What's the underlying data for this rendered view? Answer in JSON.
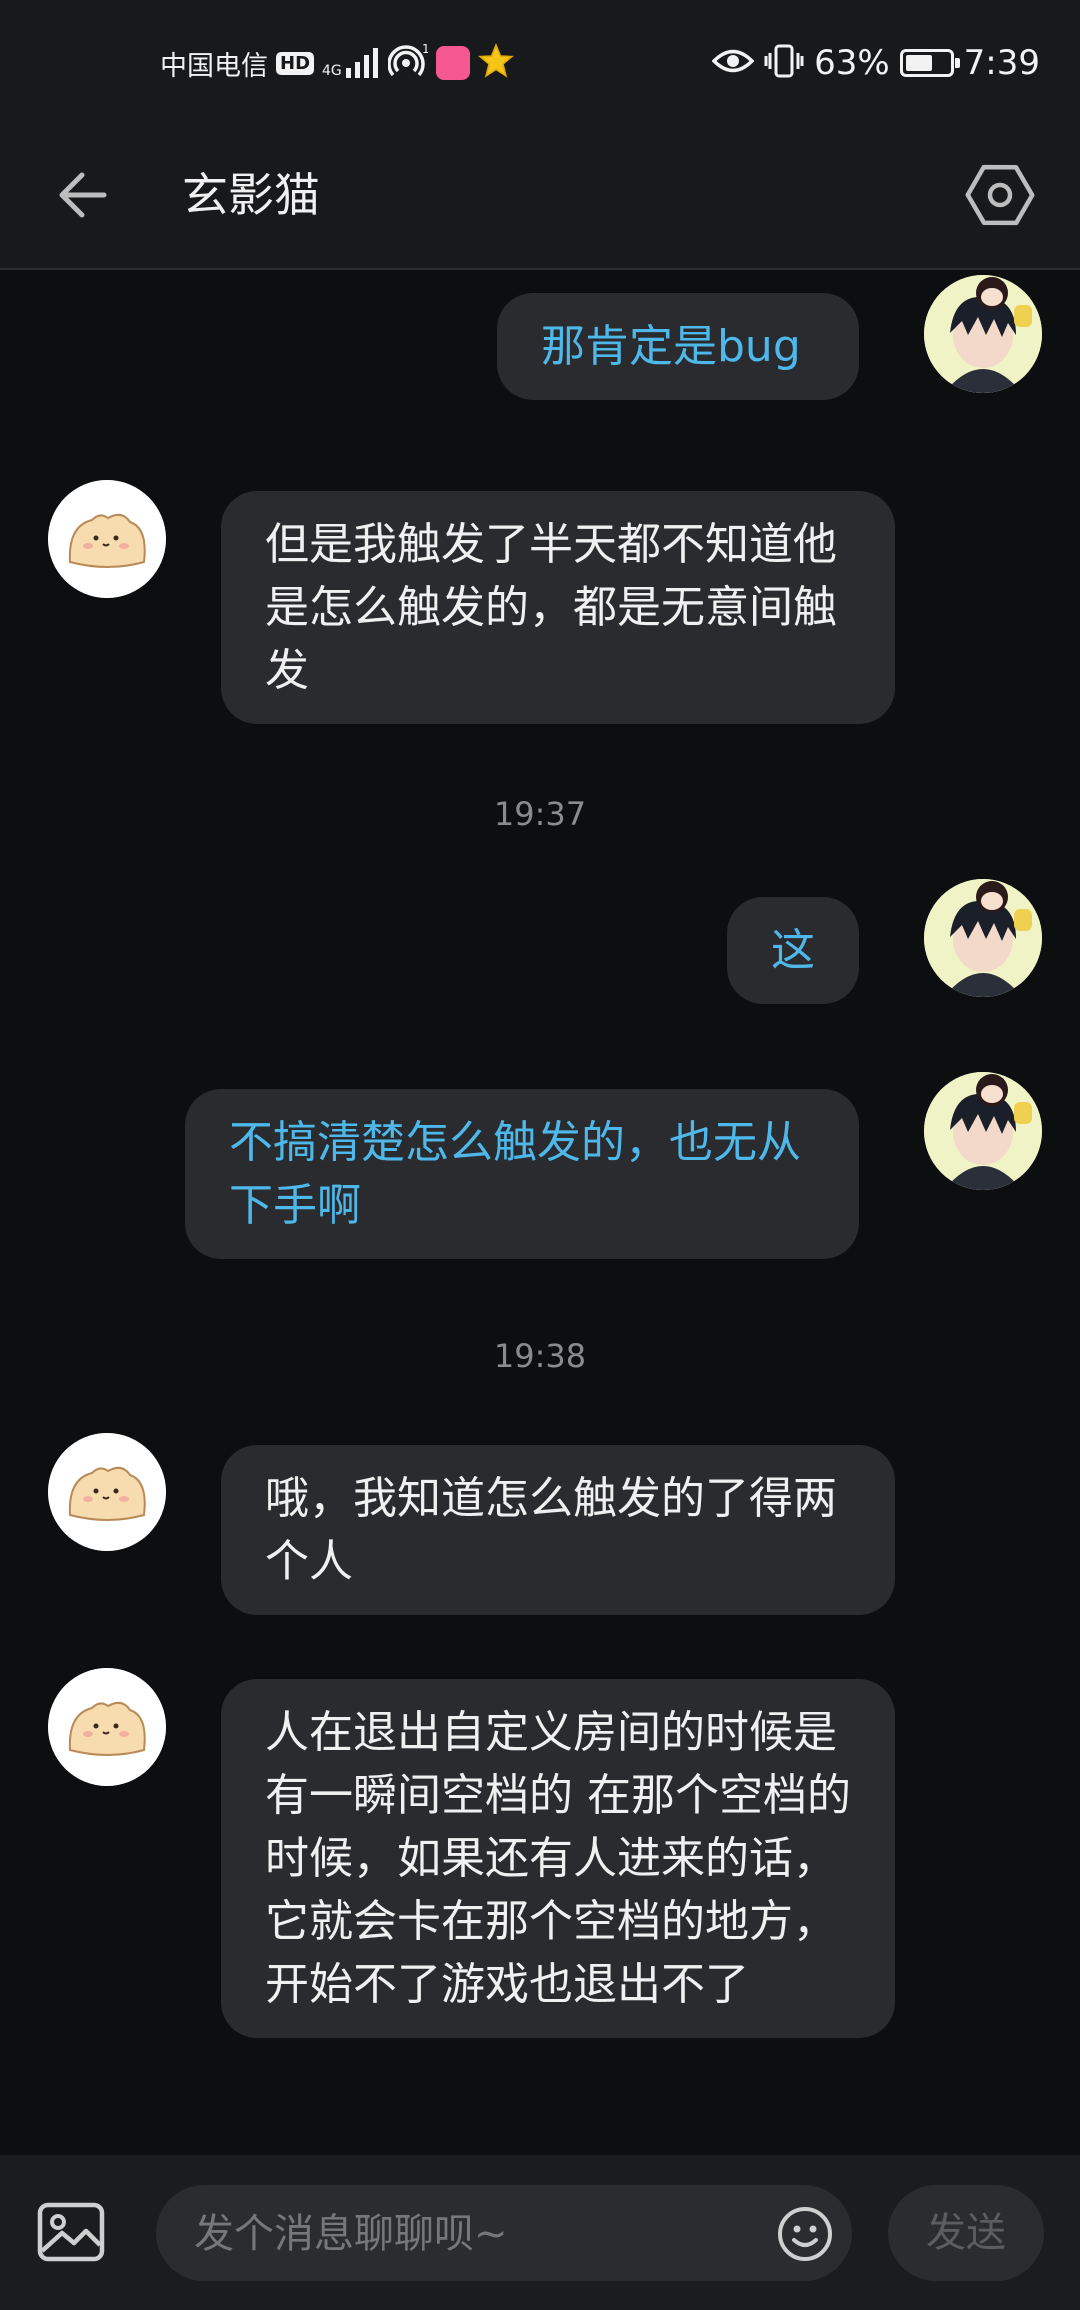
{
  "status_bar": {
    "carrier": "中国电信",
    "hd": "HD",
    "network": "4G",
    "battery_percent_label": "63%",
    "battery_level": 0.63,
    "time": "7:39"
  },
  "header": {
    "title": "玄影猫"
  },
  "messages": [
    {
      "from": "me",
      "text": "那肯定是bug"
    },
    {
      "from": "other",
      "text": "但是我触发了半天都不知道他是怎么触发的，都是无意间触发"
    },
    {
      "type": "time",
      "text": "19:37"
    },
    {
      "from": "me",
      "text": "这"
    },
    {
      "from": "me",
      "text": "不搞清楚怎么触发的，也无从下手啊"
    },
    {
      "type": "time",
      "text": "19:38"
    },
    {
      "from": "other",
      "text": "哦，我知道怎么触发的了得两个人"
    },
    {
      "from": "other",
      "text": "人在退出自定义房间的时候是有一瞬间空档的 在那个空档的时候，如果还有人进来的话，它就会卡在那个空档的地方，开始不了游戏也退出不了"
    }
  ],
  "composer": {
    "placeholder": "发个消息聊聊呗~",
    "send_label": "发送"
  },
  "colors": {
    "background": "#0d0e10",
    "bubble": "#2a2b2e",
    "my_text": "#4fb8ea",
    "other_text": "#f0f0f0"
  }
}
